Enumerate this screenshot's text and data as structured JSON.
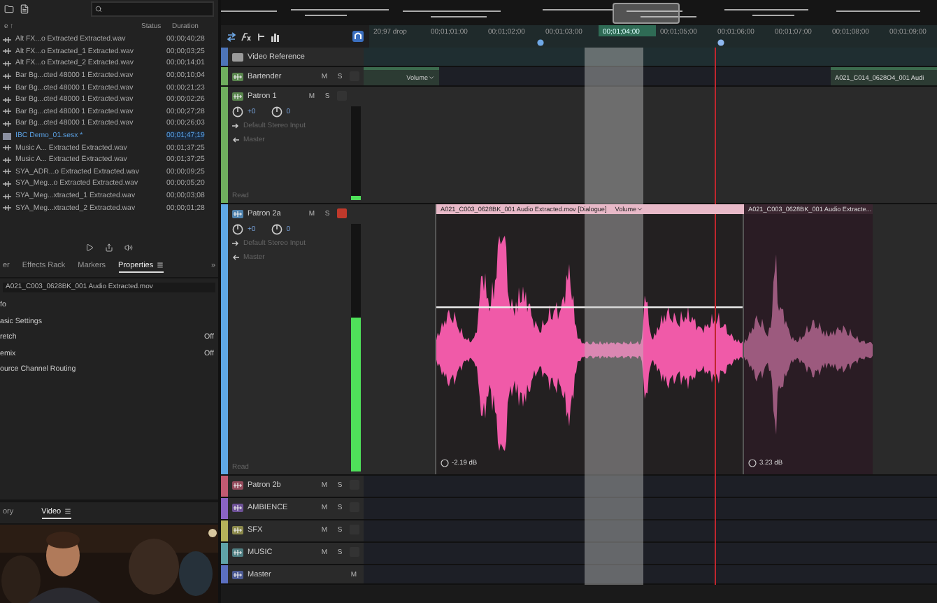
{
  "files": {
    "name_header": "e ↑",
    "columns": [
      "Status",
      "Duration"
    ],
    "rows": [
      {
        "name": "Alt FX...o Extracted Extracted.wav",
        "duration": "00;00;40;28",
        "kind": "audio",
        "selected": false
      },
      {
        "name": "Alt FX...o Extracted_1 Extracted.wav",
        "duration": "00;00;03;25",
        "kind": "audio",
        "selected": false
      },
      {
        "name": "Alt FX...o Extracted_2 Extracted.wav",
        "duration": "00;00;14;01",
        "kind": "audio",
        "selected": false
      },
      {
        "name": "Bar Bg...cted 48000 1 Extracted.wav",
        "duration": "00;00;10;04",
        "kind": "audio",
        "selected": false
      },
      {
        "name": "Bar Bg...cted 48000 1 Extracted.wav",
        "duration": "00;00;21;23",
        "kind": "audio",
        "selected": false
      },
      {
        "name": "Bar Bg...cted 48000 1 Extracted.wav",
        "duration": "00;00;02;26",
        "kind": "audio",
        "selected": false
      },
      {
        "name": "Bar Bg...cted 48000 1 Extracted.wav",
        "duration": "00;00;27;28",
        "kind": "audio",
        "selected": false
      },
      {
        "name": "Bar Bg...cted 48000 1 Extracted.wav",
        "duration": "00;00;26;03",
        "kind": "audio",
        "selected": false
      },
      {
        "name": "IBC Demo_01.sesx *",
        "duration": "00;01;47;19",
        "kind": "session",
        "selected": true
      },
      {
        "name": "Music A... Extracted Extracted.wav",
        "duration": "00;01;37;25",
        "kind": "audio",
        "selected": false
      },
      {
        "name": "Music A... Extracted Extracted.wav",
        "duration": "00;01;37;25",
        "kind": "audio",
        "selected": false
      },
      {
        "name": "SYA_ADR...o Extracted Extracted.wav",
        "duration": "00;00;09;25",
        "kind": "audio",
        "selected": false
      },
      {
        "name": "SYA_Meg...o Extracted Extracted.wav",
        "duration": "00;00;05;20",
        "kind": "audio",
        "selected": false
      },
      {
        "name": "SYA_Meg...xtracted_1 Extracted.wav",
        "duration": "00;00;03;08",
        "kind": "audio",
        "selected": false
      },
      {
        "name": "SYA_Meg...xtracted_2 Extracted.wav",
        "duration": "00;00;01;28",
        "kind": "audio",
        "selected": false
      }
    ]
  },
  "panel_tabs": [
    {
      "label": "er",
      "selected": false
    },
    {
      "label": "Effects Rack",
      "selected": false
    },
    {
      "label": "Markers",
      "selected": false
    },
    {
      "label": "Properties",
      "selected": true
    }
  ],
  "more_tabs": "»",
  "properties": {
    "file": "A021_C003_0628BK_001 Audio Extracted.mov",
    "rows": [
      {
        "label": "fo"
      },
      {
        "label": "asic Settings"
      },
      {
        "label": "retch",
        "value": "Off"
      },
      {
        "label": "emix",
        "value": "Off"
      },
      {
        "label": "ource Channel Routing"
      }
    ]
  },
  "bottom_tabs": [
    {
      "label": "ory",
      "selected": false
    },
    {
      "label": "Video",
      "selected": true
    }
  ],
  "ruler": {
    "marks": [
      {
        "label": "20;97 drop",
        "selected": false
      },
      {
        "label": "00;01;01;00",
        "selected": false
      },
      {
        "label": "00;01;02;00",
        "selected": false
      },
      {
        "label": "00;01;03;00",
        "selected": false
      },
      {
        "label": "00;01;04;00",
        "selected": true
      },
      {
        "label": "00;01;05;00",
        "selected": false
      },
      {
        "label": "00;01;06;00",
        "selected": false
      },
      {
        "label": "00;01;07;00",
        "selected": false
      },
      {
        "label": "00;01;08;00",
        "selected": false
      },
      {
        "label": "00;01;09;00",
        "selected": false
      }
    ]
  },
  "tracks": [
    {
      "name": "Video Reference",
      "kind": "video",
      "color": "#4d74b8"
    },
    {
      "name": "Bartender",
      "kind": "audio",
      "color": "#6fae5e",
      "expanded": false,
      "armed": false,
      "mute_label": "M",
      "solo_label": "S",
      "clips": [
        {
          "envelope": "Volume",
          "selected": false
        },
        {
          "title": "A021_C014_0628O4_001 Audi",
          "selected": false
        }
      ]
    },
    {
      "name": "Patron 1",
      "kind": "audio",
      "color": "#6fae5e",
      "expanded": true,
      "armed": false,
      "mute_label": "M",
      "solo_label": "S",
      "volume": "+0",
      "pan": "0",
      "input": "Default Stereo Input",
      "output": "Master",
      "automation": "Read",
      "level": 0.04
    },
    {
      "name": "Patron 2a",
      "kind": "audio",
      "color": "#5fa8e6",
      "expanded": true,
      "armed": true,
      "mute_label": "M",
      "solo_label": "S",
      "volume": "+0",
      "pan": "0",
      "input": "Default Stereo Input",
      "output": "Master",
      "automation": "Read",
      "level": 0.62,
      "clips": [
        {
          "title": "A021_C003_0628BK_001 Audio Extracted.mov [Dialogue]",
          "envelope": "Volume",
          "gain": "-2.19 dB",
          "selected": true
        },
        {
          "title": "A021_C003_0628BK_001 Audio Extracte...",
          "gain": "3.23 dB",
          "selected": false
        }
      ]
    },
    {
      "name": "Patron 2b",
      "kind": "audio",
      "color": "#c25a72",
      "expanded": false,
      "armed": false,
      "mute_label": "M",
      "solo_label": "S"
    },
    {
      "name": "AMBIENCE",
      "kind": "audio",
      "color": "#8a63c4",
      "expanded": false,
      "armed": false,
      "mute_label": "M",
      "solo_label": "S"
    },
    {
      "name": "SFX",
      "kind": "audio",
      "color": "#b5b25a",
      "expanded": false,
      "armed": false,
      "mute_label": "M",
      "solo_label": "S"
    },
    {
      "name": "MUSIC",
      "kind": "audio",
      "color": "#5fa3a8",
      "expanded": false,
      "armed": false,
      "mute_label": "M",
      "solo_label": "S"
    },
    {
      "name": "Master",
      "kind": "master",
      "color": "#5b6fc0",
      "mute_label": "M"
    }
  ]
}
